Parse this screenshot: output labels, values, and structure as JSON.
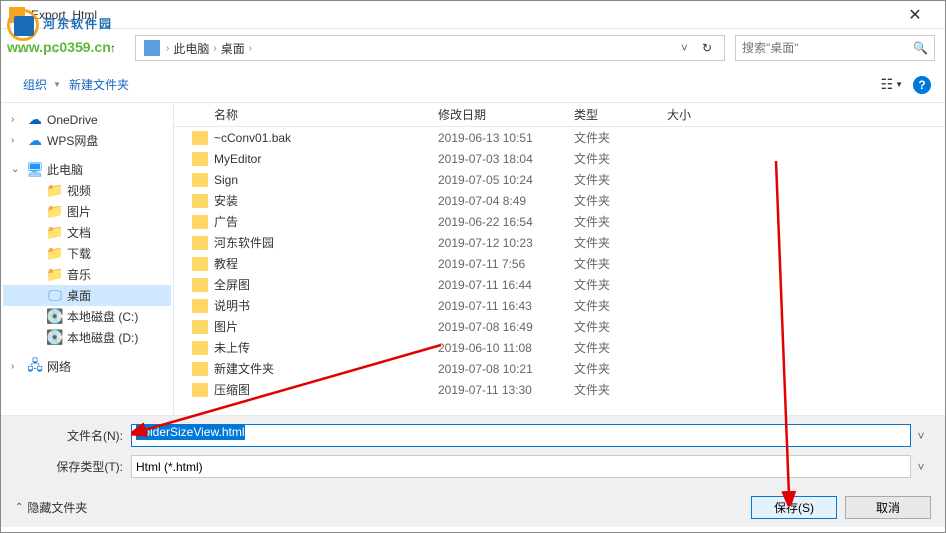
{
  "title": "Export_Html",
  "watermark": {
    "text": "河东软件园",
    "url": "www.pc0359.cn"
  },
  "nav": {
    "breadcrumb": [
      "此电脑",
      "桌面"
    ],
    "search_placeholder": "搜索\"桌面\""
  },
  "toolbar": {
    "organize": "组织",
    "newfolder": "新建文件夹"
  },
  "sidebar": {
    "items": [
      {
        "label": "OneDrive",
        "icon": "onedrive",
        "arrow": ">"
      },
      {
        "label": "WPS网盘",
        "icon": "wps",
        "arrow": ">"
      },
      {
        "label": "此电脑",
        "icon": "pc",
        "arrow": "v",
        "gap": true
      },
      {
        "label": "视频",
        "icon": "folder",
        "indent": true
      },
      {
        "label": "图片",
        "icon": "folder",
        "indent": true
      },
      {
        "label": "文档",
        "icon": "folder",
        "indent": true
      },
      {
        "label": "下载",
        "icon": "folder",
        "indent": true
      },
      {
        "label": "音乐",
        "icon": "folder",
        "indent": true
      },
      {
        "label": "桌面",
        "icon": "desktop",
        "indent": true,
        "selected": true
      },
      {
        "label": "本地磁盘 (C:)",
        "icon": "disk",
        "indent": true
      },
      {
        "label": "本地磁盘 (D:)",
        "icon": "disk",
        "indent": true
      },
      {
        "label": "网络",
        "icon": "network",
        "arrow": ">",
        "gap": true
      }
    ]
  },
  "filelist": {
    "headers": {
      "name": "名称",
      "date": "修改日期",
      "type": "类型",
      "size": "大小"
    },
    "rows": [
      {
        "name": "~cConv01.bak",
        "date": "2019-06-13 10:51",
        "type": "文件夹"
      },
      {
        "name": "MyEditor",
        "date": "2019-07-03 18:04",
        "type": "文件夹"
      },
      {
        "name": "Sign",
        "date": "2019-07-05 10:24",
        "type": "文件夹"
      },
      {
        "name": "安装",
        "date": "2019-07-04 8:49",
        "type": "文件夹"
      },
      {
        "name": "广告",
        "date": "2019-06-22 16:54",
        "type": "文件夹"
      },
      {
        "name": "河东软件园",
        "date": "2019-07-12 10:23",
        "type": "文件夹"
      },
      {
        "name": "教程",
        "date": "2019-07-11 7:56",
        "type": "文件夹"
      },
      {
        "name": "全屏图",
        "date": "2019-07-11 16:44",
        "type": "文件夹"
      },
      {
        "name": "说明书",
        "date": "2019-07-11 16:43",
        "type": "文件夹"
      },
      {
        "name": "图片",
        "date": "2019-07-08 16:49",
        "type": "文件夹"
      },
      {
        "name": "未上传",
        "date": "2019-06-10 11:08",
        "type": "文件夹"
      },
      {
        "name": "新建文件夹",
        "date": "2019-07-08 10:21",
        "type": "文件夹"
      },
      {
        "name": "压缩图",
        "date": "2019-07-11 13:30",
        "type": "文件夹"
      }
    ]
  },
  "form": {
    "filename_label": "文件名(N):",
    "filename_value": "FolderSizeView.html",
    "filetype_label": "保存类型(T):",
    "filetype_value": "Html (*.html)"
  },
  "footer": {
    "hide_folders": "隐藏文件夹",
    "save": "保存(S)",
    "cancel": "取消"
  }
}
